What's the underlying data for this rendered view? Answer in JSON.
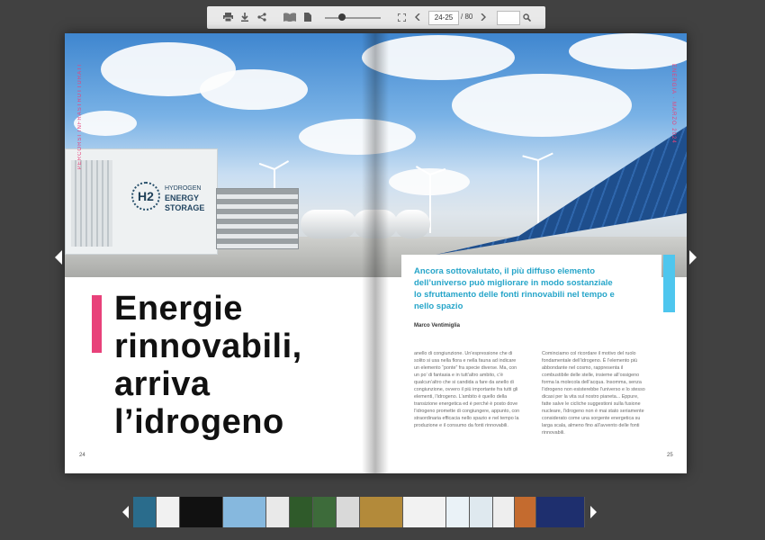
{
  "toolbar": {
    "icons": [
      "print-icon",
      "download-icon",
      "share-icon",
      "book-view-icon",
      "single-page-icon",
      "zoom-slider",
      "fullscreen-icon",
      "prev-page-icon",
      "next-page-icon",
      "search-icon"
    ],
    "page_input_value": "24-25",
    "page_total": "/ 80",
    "search_value": "",
    "zoom_level": 0.3
  },
  "spread": {
    "side_left": "PERCORSI INFRASTRUTTURATI",
    "side_right": "ENERGIA · MARZO 2024",
    "photo_labels": {
      "line1": "HYDROGEN",
      "line2": "ENERGY",
      "line3": "STORAGE",
      "badge": "H2"
    },
    "headline": [
      "Energie",
      "rinnovabili,",
      "arriva",
      "l’idrogeno"
    ],
    "subhead": "Ancora sottovalutato, il più diffuso elemento dell’universo può migliorare in modo sostanziale lo sfruttamento delle fonti rinnovabili nel tempo e nello spazio",
    "author": "Marco Ventimiglia",
    "column1": "anello di congiunzione. Un’espressione che di solito si usa nella flora e nella fauna ad indicare un elemento “ponte” fra specie diverse. Ma, con un po’ di fantasia e in tutt’altro ambito, c’è qualcun’altro che si candida a fare da anello di congiunzione, ovvero il più importante fra tutti gli elementi, l’idrogeno. L’ambito è quello della transizione energetica ed è perché è posto dove l’idrogeno promette di congiungere, appunto, con straordinaria efficacia nello spazio e nel tempo la produzione e il consumo da fonti rinnovabili.",
    "column2": "Cominciamo col ricordare il motivo del ruolo fondamentale dell’idrogeno. È l’elemento più abbondante nel cosmo, rappresenta il combustibile delle stelle, insieme all’ossigeno forma la molecola dell’acqua. Insomma, senza l’idrogeno non esisterebbe l’universo e lo stesso dicasi per la vita sul nostro pianeta... Eppure, fatte salve le cicliche suggestioni sulla fusione nucleare, l’idrogeno non è mai stato seriamente considerato come una sorgente energetica su larga scala, almeno fino all’avvento delle fonti rinnovabili.",
    "page_left": "24",
    "page_right": "25"
  },
  "thumbnails": [
    {
      "color": "#2a6c8c"
    },
    {
      "color": "#f1f1f1"
    },
    {
      "color": "#111111"
    },
    {
      "color": "#86b8de"
    },
    {
      "color": "#e9e9e9"
    },
    {
      "color": "#2f5a2a"
    },
    {
      "color": "#3d6b3a"
    },
    {
      "color": "#d9d9d9"
    },
    {
      "color": "#b38a3a"
    },
    {
      "color": "#f2f2f2"
    },
    {
      "color": "#eaf2f7"
    },
    {
      "color": "#dfe9ef"
    },
    {
      "color": "#eeeeee"
    },
    {
      "color": "#c46b2f"
    },
    {
      "color": "#1e2f6e"
    }
  ]
}
